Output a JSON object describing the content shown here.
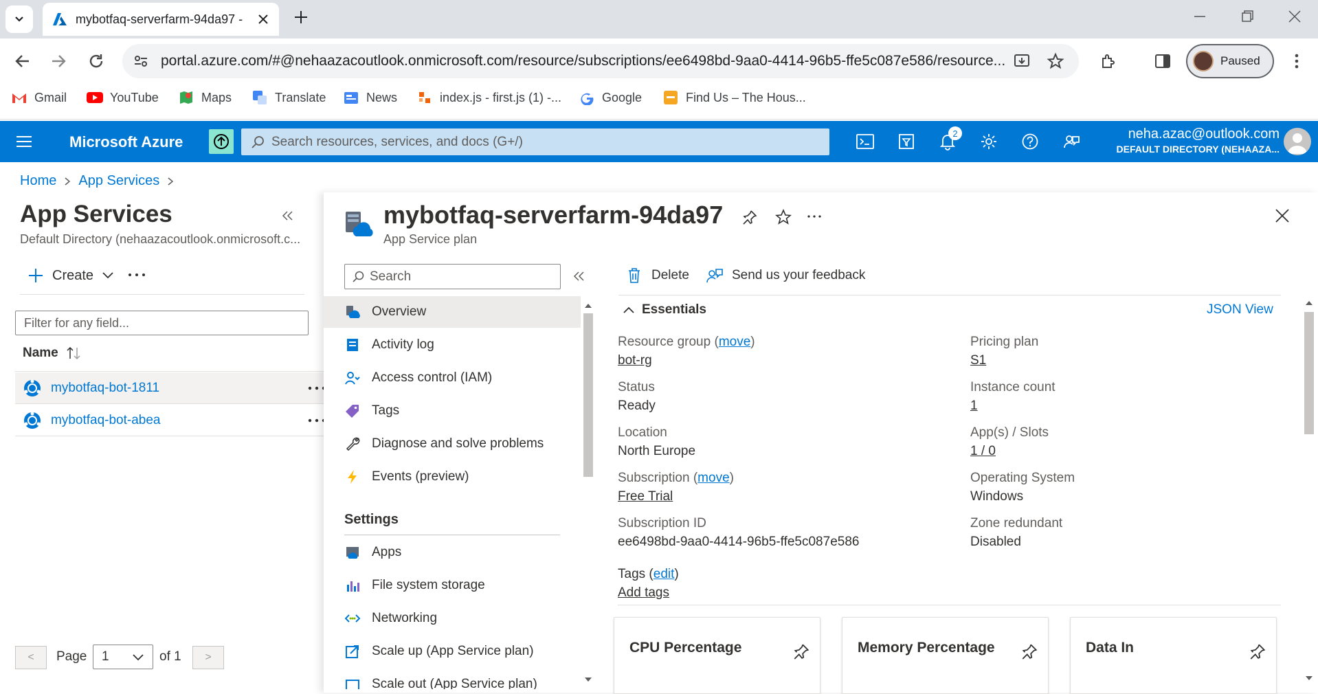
{
  "browser": {
    "tab_title": "mybotfaq-serverfarm-94da97 -",
    "url": "portal.azure.com/#@nehaazacoutlook.onmicrosoft.com/resource/subscriptions/ee6498bd-9aa0-4414-96b5-ffe5c087e586/resource...",
    "profile_label": "Paused",
    "bookmarks": [
      {
        "label": "Gmail",
        "icon": "gmail-icon"
      },
      {
        "label": "YouTube",
        "icon": "youtube-icon"
      },
      {
        "label": "Maps",
        "icon": "maps-icon"
      },
      {
        "label": "Translate",
        "icon": "translate-icon"
      },
      {
        "label": "News",
        "icon": "news-icon"
      },
      {
        "label": "index.js - first.js (1) -...",
        "icon": "code-icon"
      },
      {
        "label": "Google",
        "icon": "google-icon"
      },
      {
        "label": "Find Us – The Hous...",
        "icon": "web-icon"
      }
    ]
  },
  "azure": {
    "brand": "Microsoft Azure",
    "search_placeholder": "Search resources, services, and docs (G+/)",
    "notification_count": "2",
    "user_email": "neha.azac@outlook.com",
    "user_directory": "DEFAULT DIRECTORY (NEHAAZA...",
    "accent": "#0078d4"
  },
  "breadcrumb": {
    "home": "Home",
    "app_services": "App Services"
  },
  "left_panel": {
    "title": "App Services",
    "subtitle": "Default Directory (nehaazacoutlook.onmicrosoft.c...",
    "create_label": "Create",
    "filter_placeholder": "Filter for any field...",
    "name_header": "Name",
    "items": [
      {
        "name": "mybotfaq-bot-1811"
      },
      {
        "name": "mybotfaq-bot-abea"
      }
    ],
    "page_label": "Page",
    "page_value": "1",
    "of_label": "of 1"
  },
  "resource": {
    "title": "mybotfaq-serverfarm-94da97",
    "type": "App Service plan",
    "search_placeholder": "Search",
    "menu": [
      {
        "label": "Overview",
        "icon": "overview-icon"
      },
      {
        "label": "Activity log",
        "icon": "activity-log-icon"
      },
      {
        "label": "Access control (IAM)",
        "icon": "iam-icon"
      },
      {
        "label": "Tags",
        "icon": "tag-icon"
      },
      {
        "label": "Diagnose and solve problems",
        "icon": "wrench-icon"
      },
      {
        "label": "Events (preview)",
        "icon": "lightning-icon"
      }
    ],
    "settings_header": "Settings",
    "settings_menu": [
      {
        "label": "Apps",
        "icon": "apps-icon"
      },
      {
        "label": "File system storage",
        "icon": "storage-icon"
      },
      {
        "label": "Networking",
        "icon": "networking-icon"
      },
      {
        "label": "Scale up (App Service plan)",
        "icon": "scale-up-icon"
      },
      {
        "label": "Scale out (App Service plan)",
        "icon": "scale-out-icon"
      }
    ],
    "toolbar": {
      "delete": "Delete",
      "feedback": "Send us your feedback"
    },
    "essentials": {
      "header": "Essentials",
      "json_view": "JSON View",
      "resource_group_label": "Resource group",
      "move_link": "move",
      "resource_group_value": "bot-rg",
      "status_label": "Status",
      "status_value": "Ready",
      "location_label": "Location",
      "location_value": "North Europe",
      "subscription_label": "Subscription",
      "subscription_value": "Free Trial",
      "subscription_id_label": "Subscription ID",
      "subscription_id_value": "ee6498bd-9aa0-4414-96b5-ffe5c087e586",
      "pricing_label": "Pricing plan",
      "pricing_value": "S1",
      "instance_label": "Instance count",
      "instance_value": "1",
      "apps_label": "App(s) / Slots",
      "apps_value": "1 / 0",
      "os_label": "Operating System",
      "os_value": "Windows",
      "zone_label": "Zone redundant",
      "zone_value": "Disabled",
      "tags_label": "Tags",
      "edit_link": "edit",
      "add_tags": "Add tags"
    },
    "cards": [
      {
        "title": "CPU Percentage"
      },
      {
        "title": "Memory Percentage"
      },
      {
        "title": "Data In"
      }
    ]
  }
}
